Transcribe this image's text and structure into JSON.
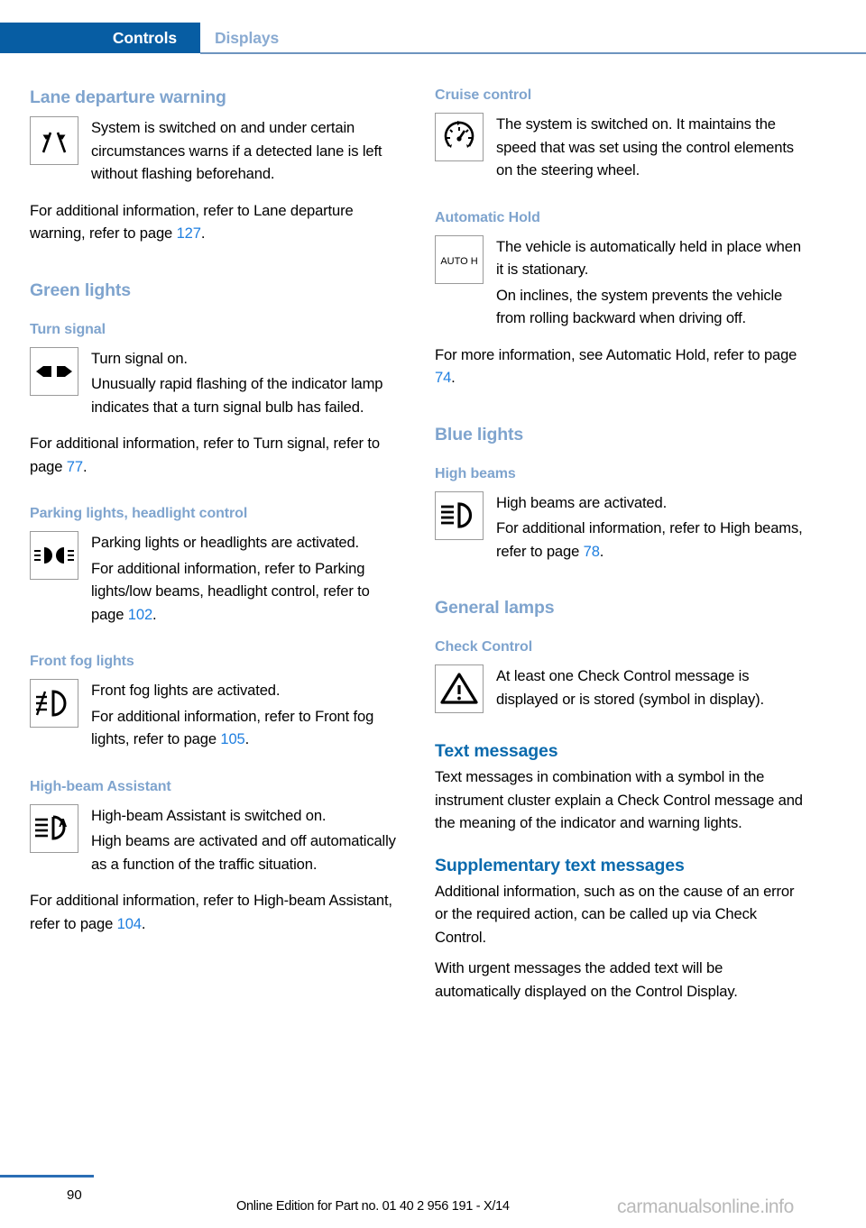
{
  "header": {
    "active_tab": "Controls",
    "inactive_tab": "Displays",
    "active_tab_color": "#075da3",
    "inactive_tab_color": "#8aabd2"
  },
  "left_column": {
    "lane_departure": {
      "heading": "Lane departure warning",
      "icon": "lane-departure-warning-icon",
      "icon_text": "System is switched on and under certain circumstances warns if a detected lane is left without flashing beforehand.",
      "paragraph_prefix": "For additional information, refer to Lane departure warning, refer to page ",
      "page_ref": "127",
      "paragraph_suffix": "."
    },
    "green_lights_heading": "Green lights",
    "turn_signal": {
      "heading": "Turn signal",
      "icon": "turn-signal-arrows-icon",
      "icon_text_1": "Turn signal on.",
      "icon_text_2": "Unusually rapid flashing of the indicator lamp indicates that a turn signal bulb has failed.",
      "paragraph_prefix": "For additional information, refer to Turn signal, refer to page ",
      "page_ref": "77",
      "paragraph_suffix": "."
    },
    "parking_lights": {
      "heading": "Parking lights, headlight control",
      "icon": "parking-lights-icon",
      "icon_text_1": "Parking lights or headlights are activated.",
      "icon_text_2_prefix": "For additional information, refer to Parking lights/low beams, headlight control, refer to page ",
      "page_ref": "102",
      "icon_text_2_suffix": "."
    },
    "front_fog_lights": {
      "heading": "Front fog lights",
      "icon": "front-fog-lights-icon",
      "icon_text_1": "Front fog lights are activated.",
      "icon_text_2_prefix": "For additional information, refer to Front fog lights, refer to page ",
      "page_ref": "105",
      "icon_text_2_suffix": "."
    },
    "high_beam_assistant": {
      "heading": "High-beam Assistant",
      "icon": "high-beam-assistant-icon",
      "icon_text_1": "High-beam Assistant is switched on.",
      "icon_text_2": "High beams are activated and off automatically as a function of the traffic situation.",
      "paragraph_prefix": "For additional information, refer to High-beam Assistant, refer to page ",
      "page_ref": "104",
      "paragraph_suffix": "."
    }
  },
  "right_column": {
    "cruise_control": {
      "heading": "Cruise control",
      "icon": "cruise-control-speedometer-icon",
      "icon_text": "The system is switched on. It maintains the speed that was set using the control elements on the steering wheel."
    },
    "automatic_hold": {
      "heading": "Automatic Hold",
      "icon": "auto-hold-icon",
      "icon_label": "AUTO H",
      "icon_text_1": "The vehicle is automatically held in place when it is stationary.",
      "icon_text_2": "On inclines, the system prevents the vehicle from rolling backward when driving off.",
      "paragraph_prefix": "For more information, see Automatic Hold, refer to page ",
      "page_ref": "74",
      "paragraph_suffix": "."
    },
    "blue_lights_heading": "Blue lights",
    "high_beams": {
      "heading": "High beams",
      "icon": "high-beams-icon",
      "icon_text_1": "High beams are activated.",
      "icon_text_2_prefix": "For additional information, refer to High beams, refer to page ",
      "page_ref": "78",
      "icon_text_2_suffix": "."
    },
    "general_lamps_heading": "General lamps",
    "check_control": {
      "heading": "Check Control",
      "icon": "warning-triangle-icon",
      "icon_text": "At least one Check Control message is displayed or is stored (symbol in display)."
    },
    "text_messages": {
      "heading": "Text messages",
      "body": "Text messages in combination with a symbol in the instrument cluster explain a Check Control message and the meaning of the indicator and warning lights."
    },
    "supplementary_text_messages": {
      "heading": "Supplementary text messages",
      "body_1": "Additional information, such as on the cause of an error or the required action, can be called up via Check Control.",
      "body_2": "With urgent messages the added text will be automatically displayed on the Control Display."
    }
  },
  "footer": {
    "page_number": "90",
    "edition": "Online Edition for Part no. 01 40 2 956 191 - X/14",
    "watermark": "carmanualsonline.info"
  }
}
